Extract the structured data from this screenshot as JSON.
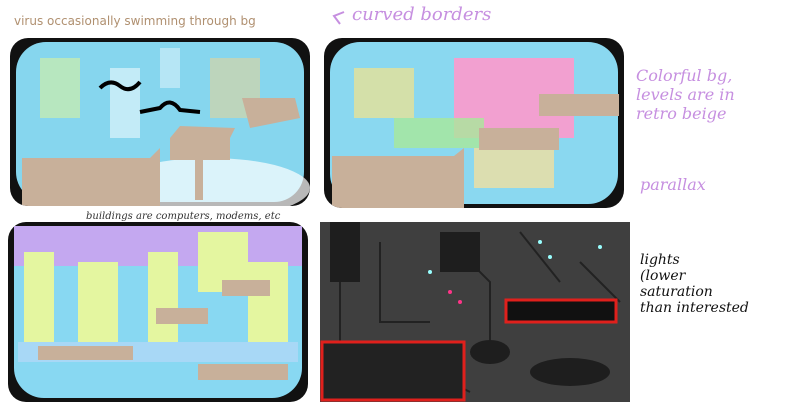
{
  "annotations": {
    "top_left_caption": "virus occasionally swimming through bg",
    "curved_borders": "curved borders",
    "colorful_bg": [
      "Colorful bg,",
      "levels are in",
      "retro beige"
    ],
    "parallax": "parallax",
    "buildings": "buildings are computers, modems, etc",
    "lights": [
      "lights",
      "(lower",
      "saturation",
      "than interested"
    ]
  },
  "colors": {
    "handwriting_purple": "#c68fe0",
    "beige_platform": "#c8b09a",
    "sky_cyan": "#7fd8f0",
    "dark_bg": "#3f3f3f",
    "red_outline": "#e0201c"
  }
}
